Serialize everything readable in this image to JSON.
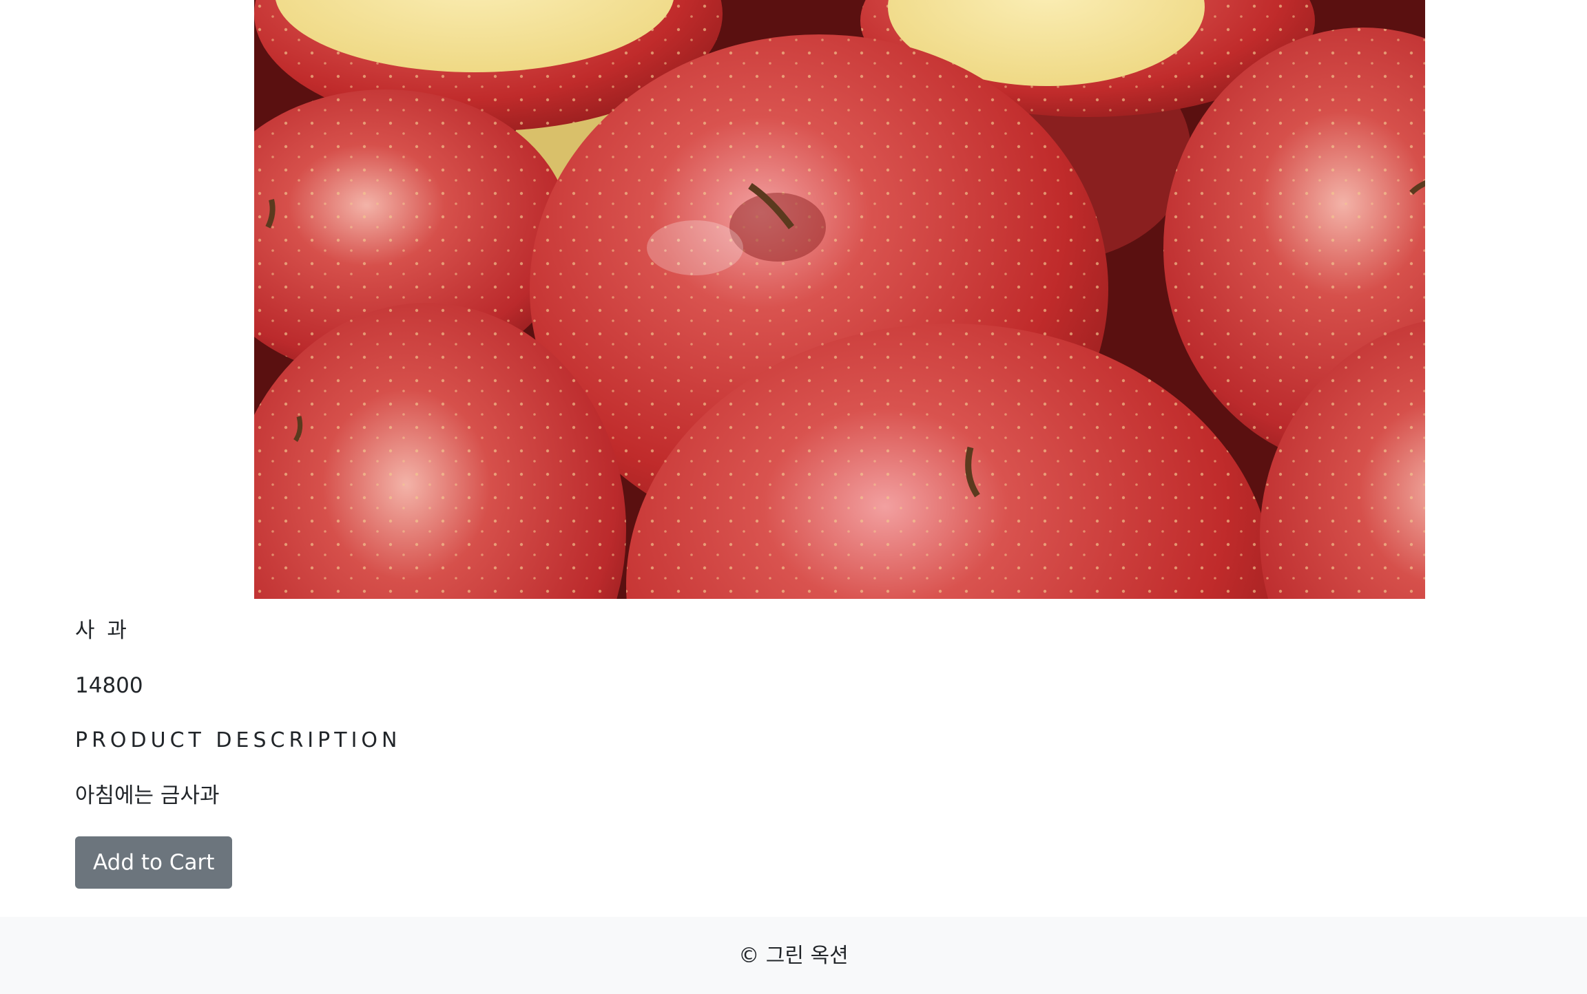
{
  "product": {
    "image_alt": "사과",
    "name": "사 과",
    "price": "14800",
    "description_heading": "Product Description",
    "description": "아침에는 금사과"
  },
  "actions": {
    "add_to_cart_label": "Add to Cart"
  },
  "footer": {
    "copyright": "© 그린 옥션"
  },
  "colors": {
    "button_bg": "#6c757d",
    "footer_bg": "#f8f9fa",
    "text": "#212529"
  }
}
